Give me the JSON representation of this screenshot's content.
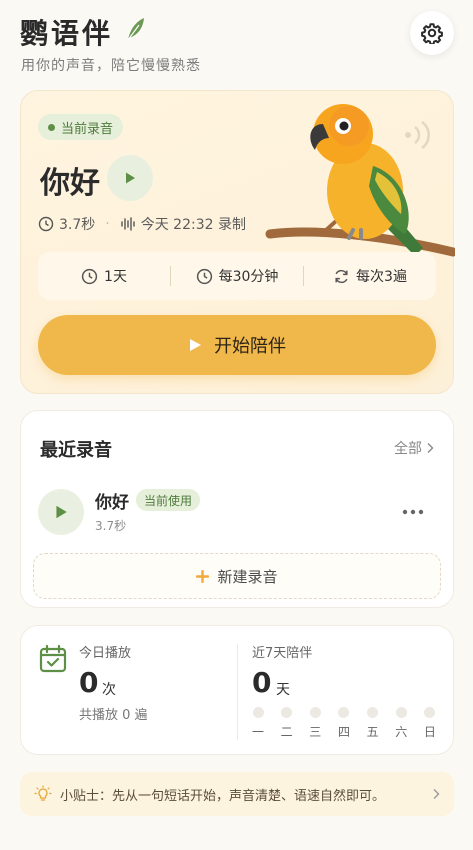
{
  "header": {
    "title": "鹦语伴",
    "subtitle": "用你的声音，陪它慢慢熟悉"
  },
  "hero": {
    "badge": "当前录音",
    "phrase": "你好",
    "duration": "3.7秒",
    "recorded_at": "今天 22:32 录制",
    "schedule": [
      {
        "icon": "clock-icon",
        "label": "1天"
      },
      {
        "icon": "clock-icon",
        "label": "每30分钟"
      },
      {
        "icon": "repeat-icon",
        "label": "每次3遍"
      }
    ],
    "start_button": "开始陪伴"
  },
  "recent": {
    "title": "最近录音",
    "all_link": "全部",
    "items": [
      {
        "name": "你好",
        "badge": "当前使用",
        "duration": "3.7秒"
      }
    ],
    "new_button": "新建录音"
  },
  "stats": {
    "today_label": "今日播放",
    "today_count": "0",
    "today_unit": "次",
    "total_plays": "共播放 0 遍",
    "week_label": "近7天陪伴",
    "week_count": "0",
    "week_unit": "天",
    "week_days": [
      "一",
      "二",
      "三",
      "四",
      "五",
      "六",
      "日"
    ]
  },
  "tip": {
    "text": "小贴士：先从一句短话开始，声音清楚、语速自然即可。"
  },
  "colors": {
    "accent": "#f0b84a",
    "green": "#5e8f47",
    "badge_bg": "#e6efd9",
    "background": "#fbf9f4"
  }
}
